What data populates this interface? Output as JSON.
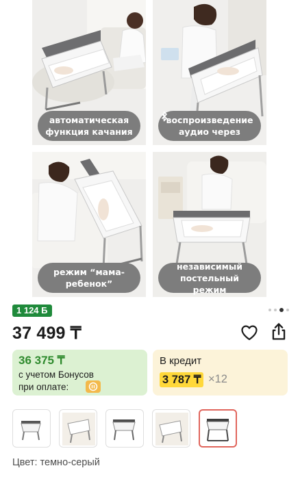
{
  "gallery": {
    "captions": [
      {
        "line1": "автоматическая",
        "line2": "функция качания"
      },
      {
        "line1": "воспроизведение",
        "line2": "аудио через"
      },
      {
        "line1": "режим “мама-",
        "line2": "ребенок”"
      },
      {
        "line1": "независимый",
        "line2": "постельный режим"
      }
    ],
    "carousel_total": 4,
    "carousel_active": 3
  },
  "product": {
    "bonus_badge": "1 124 Б",
    "price": "37 499 ₸",
    "bonus_price": "36 375 ₸",
    "bonus_note_line1": "с учетом Бонусов",
    "bonus_note_line2": "при оплате:",
    "credit_label": "В кредит",
    "credit_monthly": "3 787 ₸",
    "credit_multiplier": "×12",
    "color_line": "Цвет: темно-серый",
    "thumbnails_count": 5,
    "selected_thumbnail": 5
  },
  "colors": {
    "accent_green": "#2e8a2d",
    "badge_green": "#1f8a3b",
    "bonus_bg": "#dcf1d2",
    "credit_bg": "#fcf3d9",
    "credit_highlight": "#ffd83a",
    "selected_border": "#e0645b",
    "caption_bg": "#7d7d7d"
  }
}
